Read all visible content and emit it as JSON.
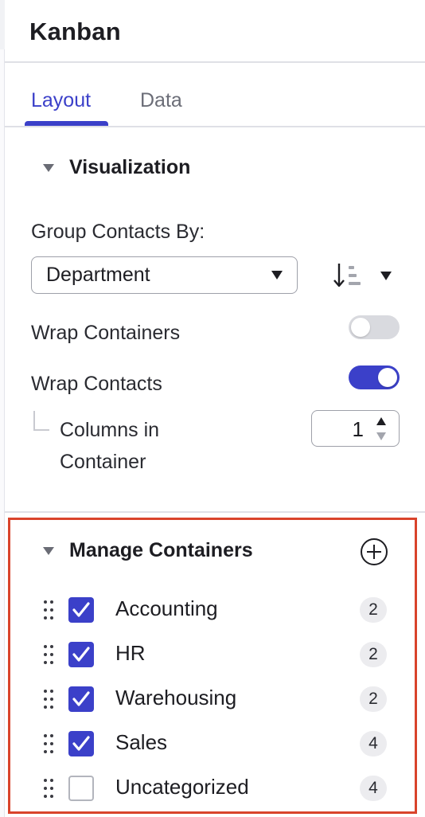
{
  "panel": {
    "title": "Kanban"
  },
  "tabs": [
    {
      "label": "Layout",
      "active": true
    },
    {
      "label": "Data",
      "active": false
    }
  ],
  "visualization": {
    "header": "Visualization",
    "group_by": {
      "label": "Group Contacts By:",
      "selected": "Department"
    },
    "sort_icon": "sort-order-icon",
    "wrap_containers": {
      "label": "Wrap Containers",
      "on": false
    },
    "wrap_contacts": {
      "label": "Wrap Contacts",
      "on": true
    },
    "columns_in_container": {
      "label": "Columns in Container",
      "value": "1"
    }
  },
  "manage_containers": {
    "header": "Manage Containers",
    "add_icon": "plus-circle-icon",
    "items": [
      {
        "label": "Accounting",
        "checked": true,
        "count": "2"
      },
      {
        "label": "HR",
        "checked": true,
        "count": "2"
      },
      {
        "label": "Warehousing",
        "checked": true,
        "count": "2"
      },
      {
        "label": "Sales",
        "checked": true,
        "count": "4"
      },
      {
        "label": "Uncategorized",
        "checked": false,
        "count": "4"
      }
    ]
  },
  "colors": {
    "accent": "#3b40c9",
    "highlight_border": "#d9432b",
    "toggle_off": "#d9dadf",
    "badge_bg": "#ececef"
  }
}
